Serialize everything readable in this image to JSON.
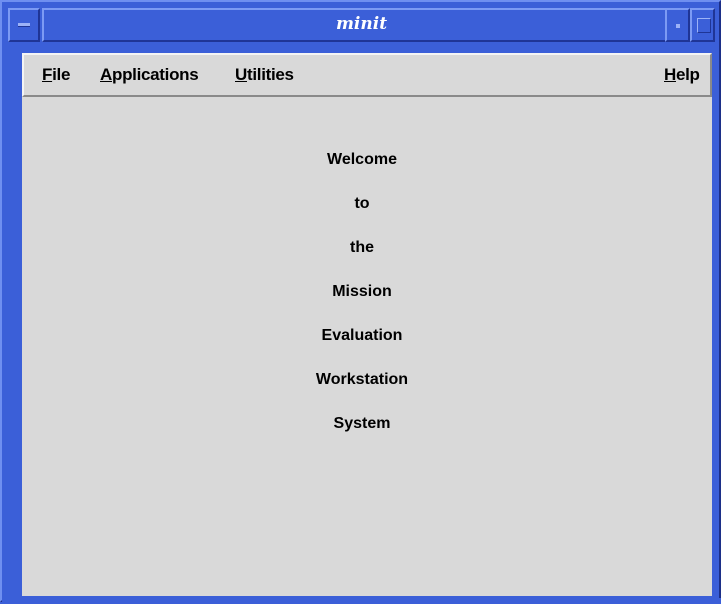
{
  "window": {
    "title": "minit"
  },
  "menubar": {
    "file": {
      "mnemonic": "F",
      "rest": "ile"
    },
    "applications": {
      "mnemonic": "A",
      "rest": "pplications"
    },
    "utilities": {
      "mnemonic": "U",
      "rest": "tilities"
    },
    "help": {
      "mnemonic": "H",
      "rest": "elp"
    }
  },
  "welcome": {
    "lines": [
      "Welcome",
      "to",
      "the",
      "Mission",
      "Evaluation",
      "Workstation",
      "System"
    ]
  },
  "colors": {
    "frame": "#3b5fd8",
    "client_bg": "#d9d9d9",
    "title_text": "#ffffff"
  },
  "icons": {
    "window_menu": "window-menu-icon",
    "minimize": "minimize-icon",
    "maximize": "maximize-icon"
  }
}
